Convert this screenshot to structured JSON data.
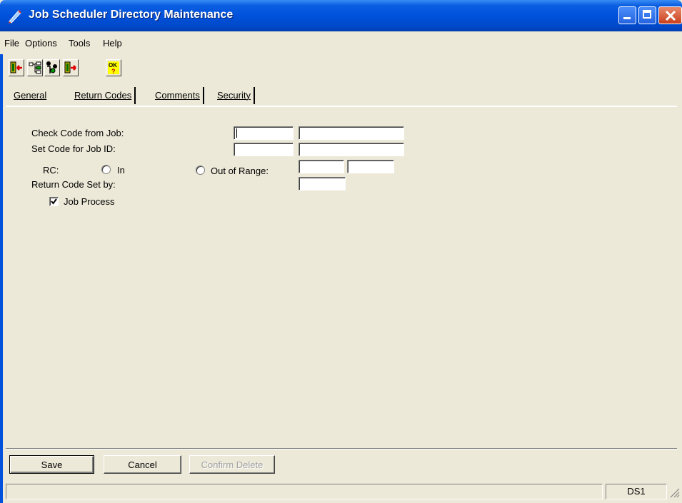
{
  "window": {
    "title": "Job Scheduler Directory Maintenance",
    "icon": "app-pencil-icon",
    "accent": "#0052dc"
  },
  "menu": {
    "items": [
      {
        "label": "File"
      },
      {
        "label": "Options"
      },
      {
        "label": "Tools"
      },
      {
        "label": "Help"
      }
    ]
  },
  "toolbar": {
    "buttons": [
      {
        "icon": "exit-door-icon"
      },
      {
        "icon": "tree-structure-icon"
      },
      {
        "icon": "people-tree-icon"
      },
      {
        "icon": "next-door-icon"
      },
      {
        "icon": "ok-help-icon"
      }
    ]
  },
  "tabs": [
    {
      "label": "General",
      "active": false
    },
    {
      "label": "Return Codes",
      "active": true
    },
    {
      "label": "Comments",
      "active": false
    },
    {
      "label": "Security",
      "active": false
    }
  ],
  "form": {
    "check_code_label": "Check Code from Job:",
    "set_code_label": "Set Code for Job ID:",
    "rc_label": "RC:",
    "in_label": "In",
    "out_of_range_label": "Out of Range:",
    "return_code_set_by_label": "Return Code Set by:",
    "job_process_label": "Job Process",
    "job_process_checked": true,
    "in_selected": false,
    "out_of_range_selected": false
  },
  "buttons": {
    "save": "Save",
    "cancel": "Cancel",
    "confirm_delete": "Confirm Delete"
  },
  "status": {
    "right_text": "DS1"
  }
}
